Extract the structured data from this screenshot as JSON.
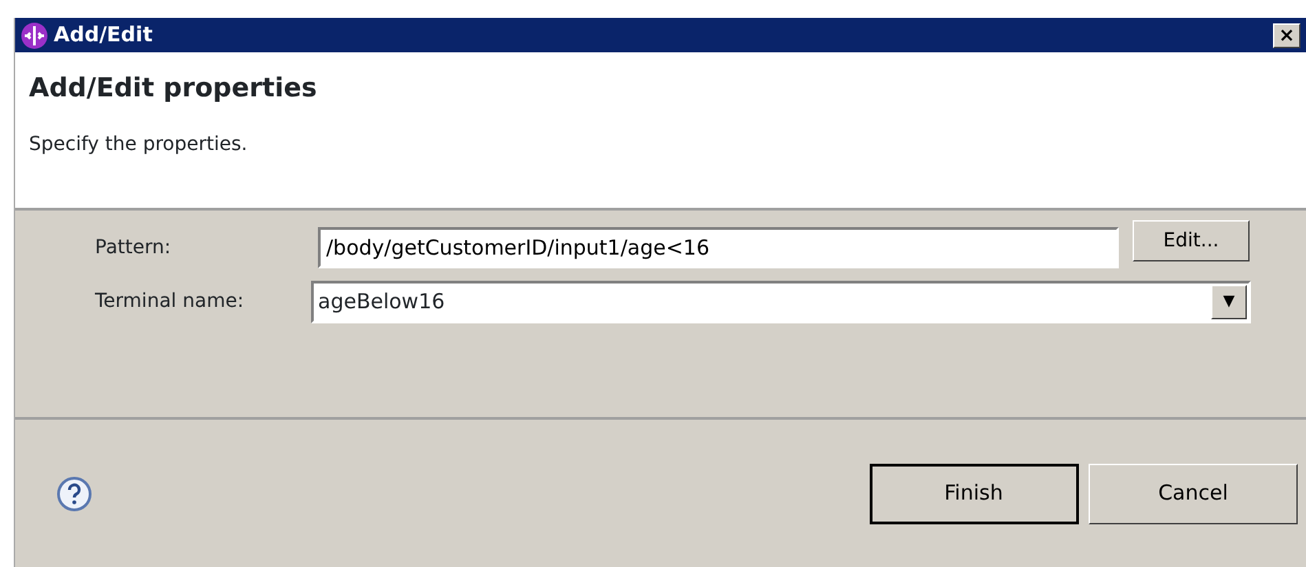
{
  "window": {
    "title": "Add/Edit",
    "close": "×"
  },
  "header": {
    "title": "Add/Edit properties",
    "description": "Specify the properties."
  },
  "fields": [
    {
      "kind": "text",
      "label": "Pattern:",
      "value": "/body/getCustomerID/input1/age<16",
      "button": "Edit..."
    },
    {
      "kind": "combo",
      "label": "Terminal name:",
      "value": "ageBelow16",
      "arrow": "▼"
    }
  ],
  "buttons": [
    {
      "label": "Finish",
      "default": true
    },
    {
      "label": "Cancel",
      "default": false
    }
  ]
}
